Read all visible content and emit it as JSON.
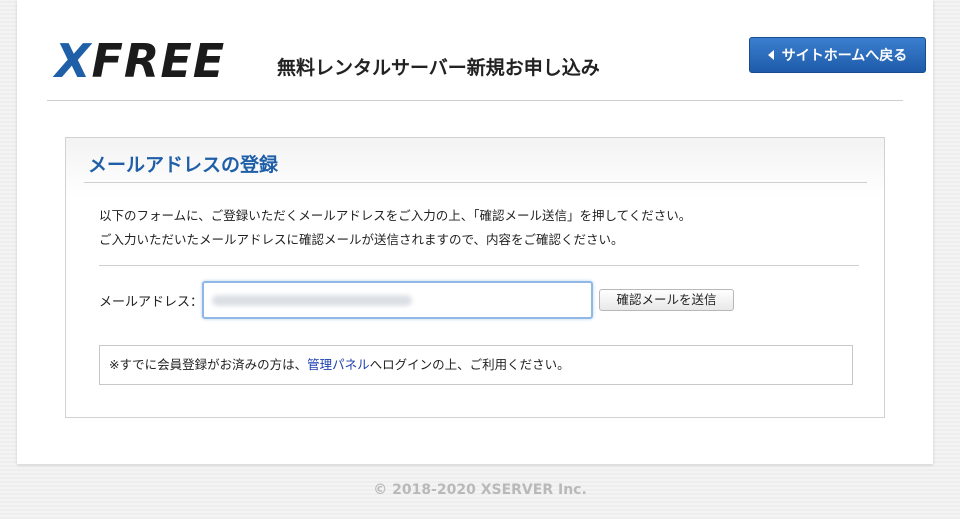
{
  "header": {
    "logo_x": "X",
    "logo_rest": "FREE",
    "tagline": "無料レンタルサーバー新規お申し込み",
    "home_button_label": "サイトホームへ戻る"
  },
  "form": {
    "title": "メールアドレスの登録",
    "desc_line1": "以下のフォームに、ご登録いただくメールアドレスをご入力の上、「確認メール送信」を押してください。",
    "desc_line2": "ご入力いただいたメールアドレスに確認メールが送信されますので、内容をご確認ください。",
    "email_label": "メールアドレス：",
    "email_value": "",
    "send_button_label": "確認メールを送信",
    "note_prefix": "※すでに会員登録がお済みの方は、",
    "note_link": "管理パネル",
    "note_suffix": "へログインの上、ご利用ください。"
  },
  "footer": {
    "copyright": "© 2018-2020 XSERVER Inc."
  },
  "colors": {
    "brand_blue": "#1f5fa8",
    "link_blue": "#1a3fb0"
  }
}
